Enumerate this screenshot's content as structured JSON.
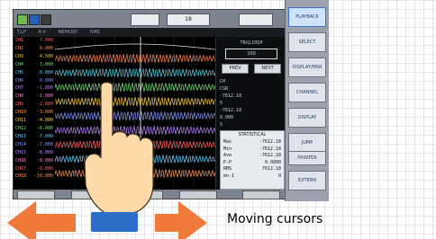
{
  "screen": {
    "topbar": {
      "field_1": "",
      "field_2": "18",
      "field_3": ""
    },
    "statusrow": {
      "items": [
        "T.LP",
        "A·V",
        "MEMORY",
        "RMS"
      ]
    },
    "channels": [
      {
        "id": "CH1",
        "value": "7.000"
      },
      {
        "id": "CH2",
        "value": "6.000"
      },
      {
        "id": "CH3",
        "value": "4.500"
      },
      {
        "id": "CH4",
        "value": "3.000"
      },
      {
        "id": "CH5",
        "value": "0.000"
      },
      {
        "id": "CH6",
        "value": "0.000"
      },
      {
        "id": "CH7",
        "value": "-1.000"
      },
      {
        "id": "CH8",
        "value": "-1.000"
      },
      {
        "id": "CH9",
        "value": "-2.000"
      },
      {
        "id": "CH10",
        "value": "-3.000"
      },
      {
        "id": "CH11",
        "value": "-4.000"
      },
      {
        "id": "CH12",
        "value": "-6.000"
      },
      {
        "id": "CH13",
        "value": "-7.000"
      },
      {
        "id": "CH14",
        "value": "-7.000"
      },
      {
        "id": "CH15",
        "value": "-8.000"
      },
      {
        "id": "CH16",
        "value": "-9.000"
      },
      {
        "id": "CH17",
        "value": "-9.000"
      },
      {
        "id": "CH18",
        "value": "-10.000"
      }
    ],
    "side": {
      "panel_title": "TRIG.DISP",
      "value_box": "100",
      "prev_label": "PREV",
      "next_label": "NEXT",
      "cursor_lines": [
        "CH",
        "CSR",
        "-7612.18",
        "5",
        "-7612.18",
        "0.000",
        "5"
      ],
      "stat_title": "STATISTICAL",
      "stats": [
        {
          "name": "Max",
          "value": "-7612.18"
        },
        {
          "name": "Min",
          "value": "-7612.18"
        },
        {
          "name": "Ave",
          "value": "-7612.18"
        },
        {
          "name": "P-P",
          "value": "0.0000"
        },
        {
          "name": "RMS",
          "value": "7612.18"
        },
        {
          "name": "σn-1",
          "value": "0"
        }
      ]
    },
    "bottombar": [
      "",
      "",
      "",
      "",
      ""
    ]
  },
  "menu": {
    "items": [
      "PLAYBACK",
      "SELECT",
      "DISPLAY/MSR SET",
      "CHANNEL",
      "DISPLAY",
      "JUMP",
      "PRINTER",
      "EXTERN"
    ]
  },
  "caption": "Moving cursors",
  "colors": {
    "left_arrow": "#f07a3a",
    "right_arrow": "#f07a3a",
    "wrist_band": "#2c6fc9",
    "hand_skin": "#ffd9a8"
  }
}
